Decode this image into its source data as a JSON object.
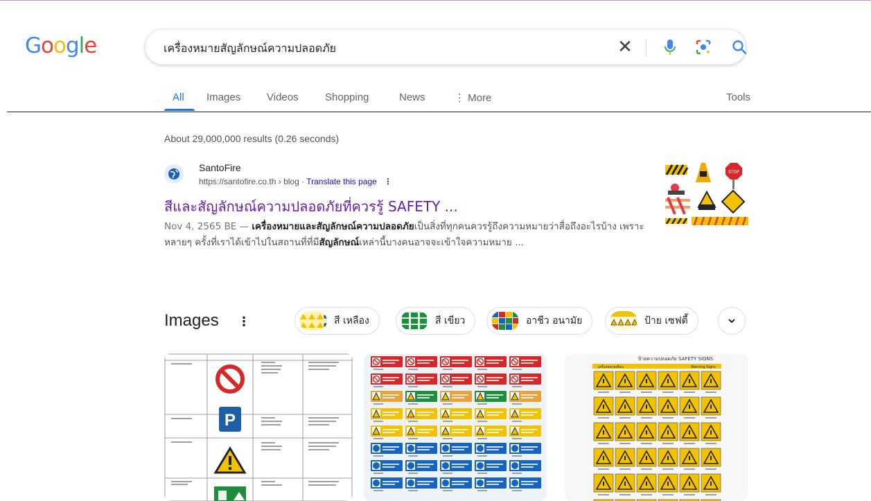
{
  "logo": {
    "text": "Google",
    "colors": [
      "#4285f4",
      "#ea4335",
      "#fbbc05",
      "#4285f4",
      "#34a853",
      "#ea4335"
    ]
  },
  "search": {
    "query": "เครื่องหมายสัญลักษณ์ความปลอดภัย",
    "clear_icon": "close-icon",
    "mic_icon": "mic-icon",
    "lens_icon": "lens-icon",
    "search_icon": "search-icon"
  },
  "tabs": {
    "items": [
      {
        "label": "All",
        "active": true
      },
      {
        "label": "Images"
      },
      {
        "label": "Videos"
      },
      {
        "label": "Shopping"
      },
      {
        "label": "News"
      },
      {
        "label": "⋮ More"
      }
    ],
    "tools": "Tools"
  },
  "result_stats": "About 29,000,000 results (0.26 seconds)",
  "result": {
    "site_name": "SantoFire",
    "url": "https://santofire.co.th",
    "breadcrumb": " › blog",
    "separator": " · ",
    "translate": "Translate this page",
    "title": "สีและสัญลักษณ์ความปลอดภัยที่ควรรู้ SAFETY ...",
    "date": "Nov 4, 2565 BE — ",
    "snippet_bold_1": "เครื่องหมายและสัญลักษณ์ความปลอดภัย",
    "snippet_1": "เป็นสิ่งที่ทุกคนควรรู้ถึงความหมายว่าสื่อถึงอะไรบ้าง เพราะหลายๆ ครั้งที่เราได้เข้าไปในสถานที่ที่มี",
    "snippet_bold_2": "สัญลักษณ์",
    "snippet_2": "เหล่านี้บางคนอาจจะเข้าใจความหมาย ..."
  },
  "images_section": {
    "heading": "Images",
    "menu": "⋮",
    "chips": [
      "สี เหลือง",
      "สี เขียว",
      "อาชีว อนามัย",
      "ป้าย เซฟตี้"
    ],
    "more_icon": "chevron-down-icon",
    "card3_title": "ป้ายความปลอดภัย SAFETY SIGNS",
    "card3_header_left": "เครื่องหมายเตือน",
    "card3_header_right": "Warning Signs"
  },
  "colors": {
    "link": "#1a0dab",
    "visited": "#681da8",
    "accent": "#1a73e8"
  }
}
